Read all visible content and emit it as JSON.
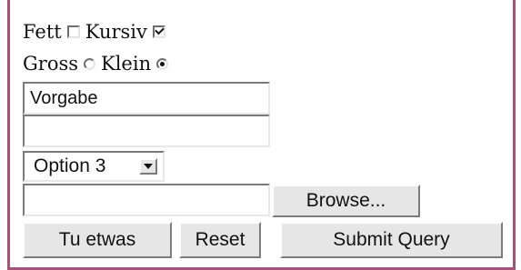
{
  "form": {
    "bold_label": "Fett",
    "italic_label": "Kursiv",
    "bold_checked": false,
    "italic_checked": true,
    "large_label": "Gross",
    "small_label": "Klein",
    "selected_size": "Klein",
    "text_input_value": "Vorgabe",
    "password_value": "",
    "select_value": "Option 3",
    "file_value": ""
  },
  "buttons": {
    "browse": "Browse...",
    "custom": "Tu etwas",
    "reset": "Reset",
    "submit": "Submit Query"
  },
  "colors": {
    "frame_border": "#a3537a",
    "button_face": "#e6e6e6"
  }
}
